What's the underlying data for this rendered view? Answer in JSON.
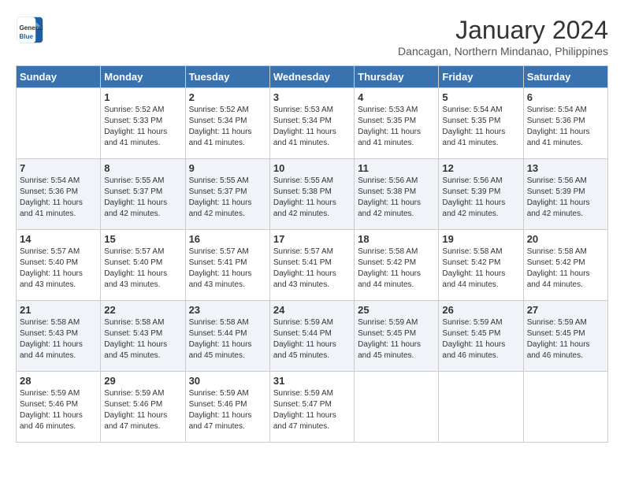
{
  "header": {
    "logo_line1": "General",
    "logo_line2": "Blue",
    "month": "January 2024",
    "location": "Dancagan, Northern Mindanao, Philippines"
  },
  "days_of_week": [
    "Sunday",
    "Monday",
    "Tuesday",
    "Wednesday",
    "Thursday",
    "Friday",
    "Saturday"
  ],
  "weeks": [
    [
      {
        "day": "",
        "sunrise": "",
        "sunset": "",
        "daylight": ""
      },
      {
        "day": "1",
        "sunrise": "5:52 AM",
        "sunset": "5:33 PM",
        "daylight": "11 hours and 41 minutes."
      },
      {
        "day": "2",
        "sunrise": "5:52 AM",
        "sunset": "5:34 PM",
        "daylight": "11 hours and 41 minutes."
      },
      {
        "day": "3",
        "sunrise": "5:53 AM",
        "sunset": "5:34 PM",
        "daylight": "11 hours and 41 minutes."
      },
      {
        "day": "4",
        "sunrise": "5:53 AM",
        "sunset": "5:35 PM",
        "daylight": "11 hours and 41 minutes."
      },
      {
        "day": "5",
        "sunrise": "5:54 AM",
        "sunset": "5:35 PM",
        "daylight": "11 hours and 41 minutes."
      },
      {
        "day": "6",
        "sunrise": "5:54 AM",
        "sunset": "5:36 PM",
        "daylight": "11 hours and 41 minutes."
      }
    ],
    [
      {
        "day": "7",
        "sunrise": "5:54 AM",
        "sunset": "5:36 PM",
        "daylight": "11 hours and 41 minutes."
      },
      {
        "day": "8",
        "sunrise": "5:55 AM",
        "sunset": "5:37 PM",
        "daylight": "11 hours and 42 minutes."
      },
      {
        "day": "9",
        "sunrise": "5:55 AM",
        "sunset": "5:37 PM",
        "daylight": "11 hours and 42 minutes."
      },
      {
        "day": "10",
        "sunrise": "5:55 AM",
        "sunset": "5:38 PM",
        "daylight": "11 hours and 42 minutes."
      },
      {
        "day": "11",
        "sunrise": "5:56 AM",
        "sunset": "5:38 PM",
        "daylight": "11 hours and 42 minutes."
      },
      {
        "day": "12",
        "sunrise": "5:56 AM",
        "sunset": "5:39 PM",
        "daylight": "11 hours and 42 minutes."
      },
      {
        "day": "13",
        "sunrise": "5:56 AM",
        "sunset": "5:39 PM",
        "daylight": "11 hours and 42 minutes."
      }
    ],
    [
      {
        "day": "14",
        "sunrise": "5:57 AM",
        "sunset": "5:40 PM",
        "daylight": "11 hours and 43 minutes."
      },
      {
        "day": "15",
        "sunrise": "5:57 AM",
        "sunset": "5:40 PM",
        "daylight": "11 hours and 43 minutes."
      },
      {
        "day": "16",
        "sunrise": "5:57 AM",
        "sunset": "5:41 PM",
        "daylight": "11 hours and 43 minutes."
      },
      {
        "day": "17",
        "sunrise": "5:57 AM",
        "sunset": "5:41 PM",
        "daylight": "11 hours and 43 minutes."
      },
      {
        "day": "18",
        "sunrise": "5:58 AM",
        "sunset": "5:42 PM",
        "daylight": "11 hours and 44 minutes."
      },
      {
        "day": "19",
        "sunrise": "5:58 AM",
        "sunset": "5:42 PM",
        "daylight": "11 hours and 44 minutes."
      },
      {
        "day": "20",
        "sunrise": "5:58 AM",
        "sunset": "5:42 PM",
        "daylight": "11 hours and 44 minutes."
      }
    ],
    [
      {
        "day": "21",
        "sunrise": "5:58 AM",
        "sunset": "5:43 PM",
        "daylight": "11 hours and 44 minutes."
      },
      {
        "day": "22",
        "sunrise": "5:58 AM",
        "sunset": "5:43 PM",
        "daylight": "11 hours and 45 minutes."
      },
      {
        "day": "23",
        "sunrise": "5:58 AM",
        "sunset": "5:44 PM",
        "daylight": "11 hours and 45 minutes."
      },
      {
        "day": "24",
        "sunrise": "5:59 AM",
        "sunset": "5:44 PM",
        "daylight": "11 hours and 45 minutes."
      },
      {
        "day": "25",
        "sunrise": "5:59 AM",
        "sunset": "5:45 PM",
        "daylight": "11 hours and 45 minutes."
      },
      {
        "day": "26",
        "sunrise": "5:59 AM",
        "sunset": "5:45 PM",
        "daylight": "11 hours and 46 minutes."
      },
      {
        "day": "27",
        "sunrise": "5:59 AM",
        "sunset": "5:45 PM",
        "daylight": "11 hours and 46 minutes."
      }
    ],
    [
      {
        "day": "28",
        "sunrise": "5:59 AM",
        "sunset": "5:46 PM",
        "daylight": "11 hours and 46 minutes."
      },
      {
        "day": "29",
        "sunrise": "5:59 AM",
        "sunset": "5:46 PM",
        "daylight": "11 hours and 47 minutes."
      },
      {
        "day": "30",
        "sunrise": "5:59 AM",
        "sunset": "5:46 PM",
        "daylight": "11 hours and 47 minutes."
      },
      {
        "day": "31",
        "sunrise": "5:59 AM",
        "sunset": "5:47 PM",
        "daylight": "11 hours and 47 minutes."
      },
      {
        "day": "",
        "sunrise": "",
        "sunset": "",
        "daylight": ""
      },
      {
        "day": "",
        "sunrise": "",
        "sunset": "",
        "daylight": ""
      },
      {
        "day": "",
        "sunrise": "",
        "sunset": "",
        "daylight": ""
      }
    ]
  ]
}
